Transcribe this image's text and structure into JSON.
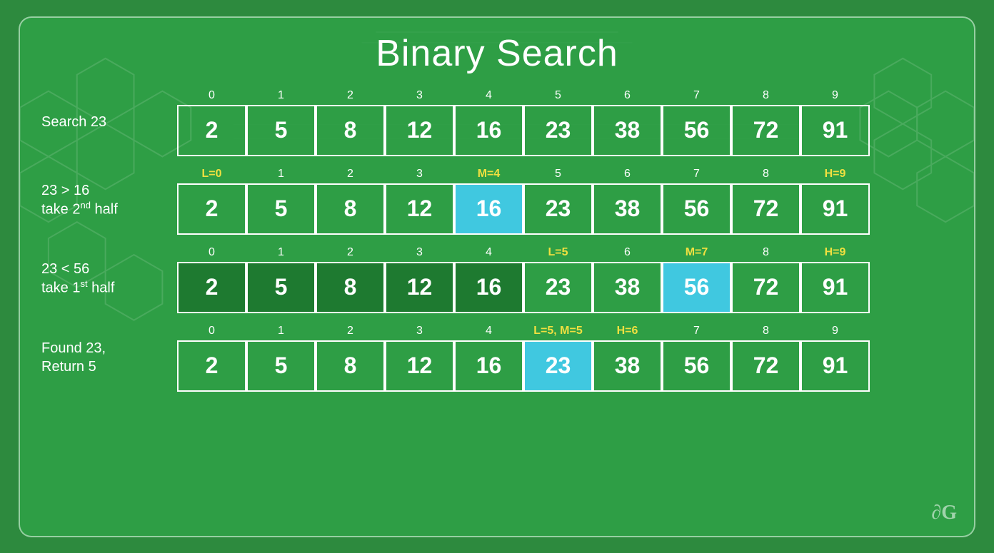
{
  "title": "Binary Search",
  "rows": [
    {
      "label": "Search 23",
      "label_html": "Search 23",
      "indices": [
        {
          "val": "0",
          "class": ""
        },
        {
          "val": "1",
          "class": ""
        },
        {
          "val": "2",
          "class": ""
        },
        {
          "val": "3",
          "class": ""
        },
        {
          "val": "4",
          "class": ""
        },
        {
          "val": "5",
          "class": ""
        },
        {
          "val": "6",
          "class": ""
        },
        {
          "val": "7",
          "class": ""
        },
        {
          "val": "8",
          "class": ""
        },
        {
          "val": "9",
          "class": ""
        }
      ],
      "cells": [
        {
          "val": "2",
          "class": ""
        },
        {
          "val": "5",
          "class": ""
        },
        {
          "val": "8",
          "class": ""
        },
        {
          "val": "12",
          "class": ""
        },
        {
          "val": "16",
          "class": ""
        },
        {
          "val": "23",
          "class": ""
        },
        {
          "val": "38",
          "class": ""
        },
        {
          "val": "56",
          "class": ""
        },
        {
          "val": "72",
          "class": ""
        },
        {
          "val": "91",
          "class": ""
        }
      ]
    },
    {
      "label": "23 &gt; 16\ntake 2nd half",
      "label_html": "23 &gt; 16<br>take 2<sup>nd</sup> half",
      "indices": [
        {
          "val": "L=0",
          "class": "yellow"
        },
        {
          "val": "1",
          "class": ""
        },
        {
          "val": "2",
          "class": ""
        },
        {
          "val": "3",
          "class": ""
        },
        {
          "val": "M=4",
          "class": "yellow"
        },
        {
          "val": "5",
          "class": ""
        },
        {
          "val": "6",
          "class": ""
        },
        {
          "val": "7",
          "class": ""
        },
        {
          "val": "8",
          "class": ""
        },
        {
          "val": "H=9",
          "class": "yellow"
        }
      ],
      "cells": [
        {
          "val": "2",
          "class": ""
        },
        {
          "val": "5",
          "class": ""
        },
        {
          "val": "8",
          "class": ""
        },
        {
          "val": "12",
          "class": ""
        },
        {
          "val": "16",
          "class": "highlight-blue"
        },
        {
          "val": "23",
          "class": ""
        },
        {
          "val": "38",
          "class": ""
        },
        {
          "val": "56",
          "class": ""
        },
        {
          "val": "72",
          "class": ""
        },
        {
          "val": "91",
          "class": ""
        }
      ]
    },
    {
      "label": "23 &lt; 56\ntake 1st half",
      "label_html": "23 &lt; 56<br>take 1<sup>st</sup> half",
      "indices": [
        {
          "val": "0",
          "class": ""
        },
        {
          "val": "1",
          "class": ""
        },
        {
          "val": "2",
          "class": ""
        },
        {
          "val": "3",
          "class": ""
        },
        {
          "val": "4",
          "class": ""
        },
        {
          "val": "L=5",
          "class": "yellow"
        },
        {
          "val": "6",
          "class": ""
        },
        {
          "val": "M=7",
          "class": "yellow"
        },
        {
          "val": "8",
          "class": ""
        },
        {
          "val": "H=9",
          "class": "yellow"
        }
      ],
      "cells": [
        {
          "val": "2",
          "class": "dark-green"
        },
        {
          "val": "5",
          "class": "dark-green"
        },
        {
          "val": "8",
          "class": "dark-green"
        },
        {
          "val": "12",
          "class": "dark-green"
        },
        {
          "val": "16",
          "class": "dark-green"
        },
        {
          "val": "23",
          "class": ""
        },
        {
          "val": "38",
          "class": ""
        },
        {
          "val": "56",
          "class": "highlight-blue"
        },
        {
          "val": "72",
          "class": ""
        },
        {
          "val": "91",
          "class": ""
        }
      ]
    },
    {
      "label": "Found 23,\nReturn 5",
      "label_html": "Found 23,<br>Return 5",
      "indices": [
        {
          "val": "0",
          "class": ""
        },
        {
          "val": "1",
          "class": ""
        },
        {
          "val": "2",
          "class": ""
        },
        {
          "val": "3",
          "class": ""
        },
        {
          "val": "4",
          "class": ""
        },
        {
          "val": "L=5, M=5",
          "class": "yellow"
        },
        {
          "val": "H=6",
          "class": "yellow"
        },
        {
          "val": "7",
          "class": ""
        },
        {
          "val": "8",
          "class": ""
        },
        {
          "val": "9",
          "class": ""
        }
      ],
      "cells": [
        {
          "val": "2",
          "class": ""
        },
        {
          "val": "5",
          "class": ""
        },
        {
          "val": "8",
          "class": ""
        },
        {
          "val": "12",
          "class": ""
        },
        {
          "val": "16",
          "class": ""
        },
        {
          "val": "23",
          "class": "highlight-blue"
        },
        {
          "val": "38",
          "class": ""
        },
        {
          "val": "56",
          "class": ""
        },
        {
          "val": "72",
          "class": ""
        },
        {
          "val": "91",
          "class": ""
        }
      ]
    }
  ],
  "logo": "∂G"
}
